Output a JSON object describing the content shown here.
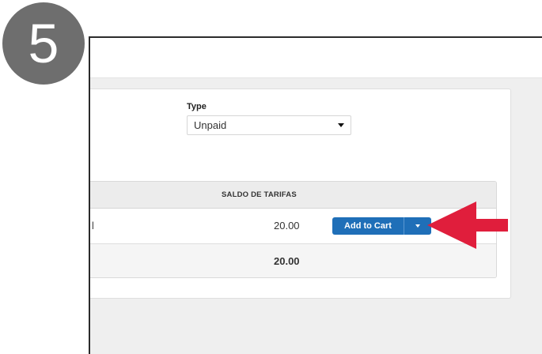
{
  "step": {
    "number": "5"
  },
  "form": {
    "type_label": "Type",
    "type_value": "Unpaid"
  },
  "table": {
    "column_header": "SALDO DE TARIFAS",
    "rows": [
      {
        "left_text": "l",
        "amount": "20.00",
        "add_to_cart_label": "Add to Cart"
      }
    ],
    "total": "20.00"
  },
  "colors": {
    "step_badge": "#6e6e6e",
    "button_primary": "#1f6fb8",
    "arrow": "#e01e3c"
  },
  "icons": {
    "select_caret": "chevron-down-icon",
    "split_caret": "caret-down-icon",
    "pointer_arrow": "arrow-left-icon"
  }
}
